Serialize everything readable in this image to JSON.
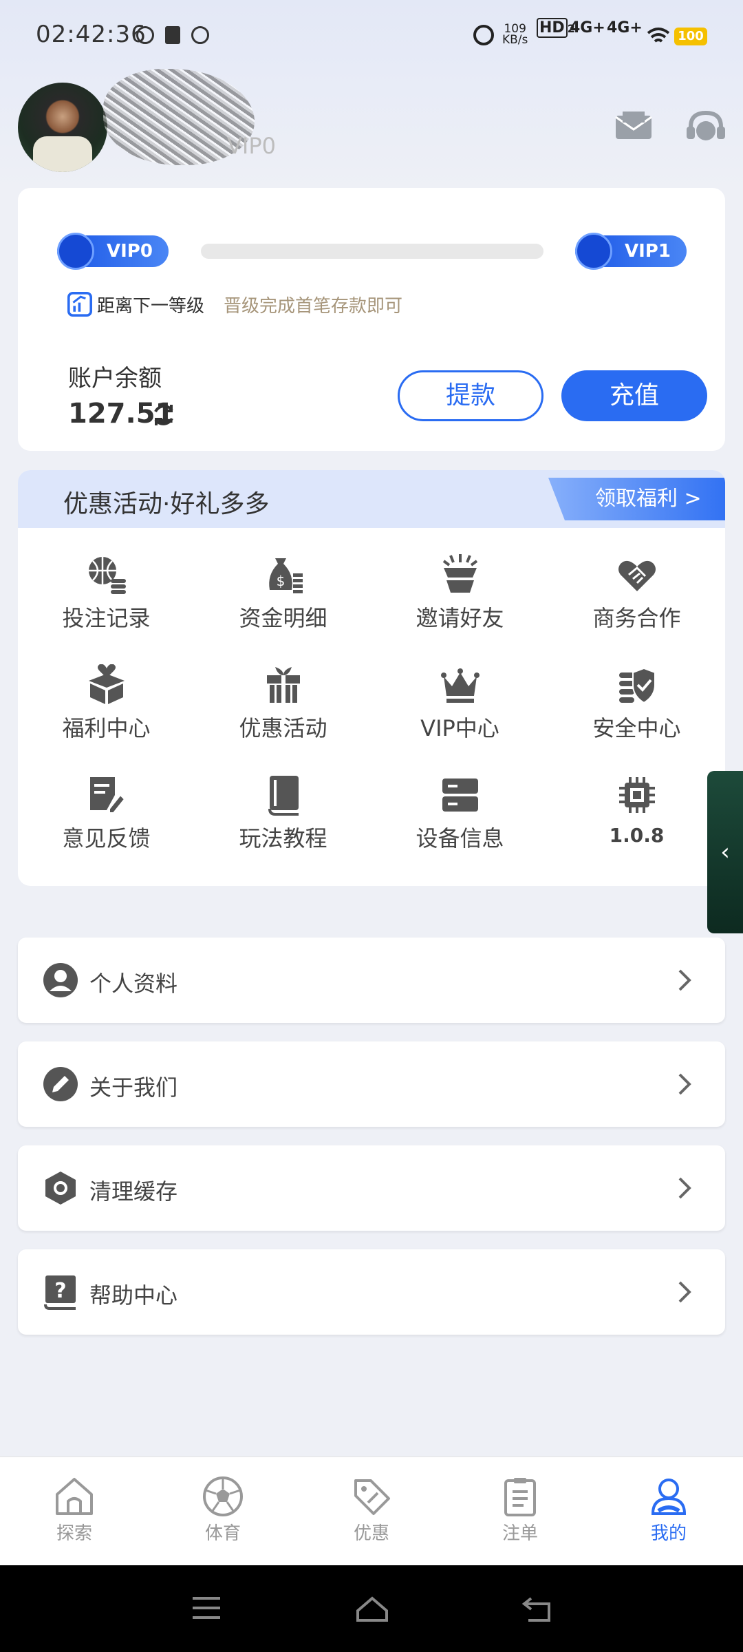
{
  "status_bar": {
    "time": "02:42:36",
    "net_speed_value": "109",
    "net_speed_unit": "KB/s",
    "hd_label": "HD",
    "hd_sub": "2",
    "sig1": "4G+",
    "sig2": "4G+",
    "battery": "100"
  },
  "profile": {
    "vip_level_label": "VIP0"
  },
  "account_card": {
    "current_vip": "VIP0",
    "next_vip": "VIP1",
    "progress_fraction": 0,
    "next_level_label": "距离下一等级",
    "next_level_desc": "晋级完成首笔存款即可",
    "balance_label": "账户余额",
    "balance_value": "127.51",
    "withdraw_label": "提款",
    "deposit_label": "充值"
  },
  "promo": {
    "title": "优惠活动·好礼多多",
    "claim_label": "领取福利 >"
  },
  "grid": [
    {
      "label": "投注记录",
      "icon": "basketball-coins-icon"
    },
    {
      "label": "资金明细",
      "icon": "money-bag-icon"
    },
    {
      "label": "邀请好友",
      "icon": "invite-gift-icon"
    },
    {
      "label": "商务合作",
      "icon": "heart-handshake-icon"
    },
    {
      "label": "福利中心",
      "icon": "heart-box-icon"
    },
    {
      "label": "优惠活动",
      "icon": "gift-icon"
    },
    {
      "label": "VIP中心",
      "icon": "crown-icon"
    },
    {
      "label": "安全中心",
      "icon": "shield-check-icon"
    },
    {
      "label": "意见反馈",
      "icon": "feedback-edit-icon"
    },
    {
      "label": "玩法教程",
      "icon": "book-icon"
    },
    {
      "label": "设备信息",
      "icon": "server-icon"
    },
    {
      "label": "1.0.8",
      "icon": "chip-icon"
    }
  ],
  "side_tab": {
    "label": "‹"
  },
  "list": [
    {
      "label": "个人资料",
      "icon": "user-circle-icon"
    },
    {
      "label": "关于我们",
      "icon": "pencil-circle-icon"
    },
    {
      "label": "清理缓存",
      "icon": "hexagon-icon"
    },
    {
      "label": "帮助中心",
      "icon": "help-book-icon"
    }
  ],
  "bottom_nav": [
    {
      "label": "探索",
      "icon": "home-icon",
      "active": false
    },
    {
      "label": "体育",
      "icon": "soccer-ball-icon",
      "active": false
    },
    {
      "label": "优惠",
      "icon": "tag-icon",
      "active": false
    },
    {
      "label": "注单",
      "icon": "clipboard-icon",
      "active": false
    },
    {
      "label": "我的",
      "icon": "user-icon",
      "active": true
    }
  ],
  "colors": {
    "accent": "#2a6cf2",
    "gold_text": "#a6957a",
    "icon_gray": "#555555"
  }
}
